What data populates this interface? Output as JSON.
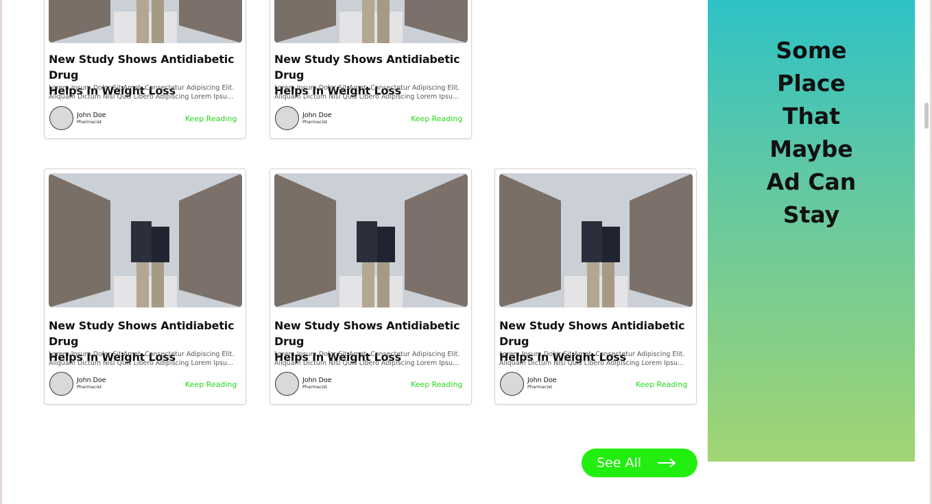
{
  "cards": [
    {
      "title_line1": "New Study Shows Antidiabetic Drug",
      "title_line2": "Helps In Weight Loss",
      "excerpt_line1": "Lorem Ipsum Dolor Sit Amet, Consectetur Adipiscing Elit.",
      "excerpt_line2": "Aliquam Dictum Nisl Quis Libero Adipiscing Lorem Ipsum D...",
      "author_name": "John Doe",
      "author_role": "Pharmacist",
      "cta": "Keep Reading"
    },
    {
      "title_line1": "New Study Shows Antidiabetic Drug",
      "title_line2": "Helps In Weight Loss",
      "excerpt_line1": "Lorem Ipsum Dolor Sit Amet, Consectetur Adipiscing Elit.",
      "excerpt_line2": "Aliquam Dictum Nisl Quis Libero Adipiscing Lorem Ipsum D...",
      "author_name": "John Doe",
      "author_role": "Pharmacist",
      "cta": "Keep Reading"
    },
    {
      "title_line1": "New Study Shows Antidiabetic Drug",
      "title_line2": "Helps In Weight Loss",
      "excerpt_line1": "Lorem Ipsum Dolor Sit Amet, Consectetur Adipiscing Elit.",
      "excerpt_line2": "Aliquam Dictum Nisl Quis Libero Adipiscing Lorem Ipsum D...",
      "author_name": "John Doe",
      "author_role": "Pharmacist",
      "cta": "Keep Reading"
    },
    {
      "title_line1": "New Study Shows Antidiabetic Drug",
      "title_line2": "Helps In Weight Loss",
      "excerpt_line1": "Lorem Ipsum Dolor Sit Amet, Consectetur Adipiscing Elit.",
      "excerpt_line2": "Aliquam Dictum Nisl Quis Libero Adipiscing Lorem Ipsum D...",
      "author_name": "John Doe",
      "author_role": "Pharmacist",
      "cta": "Keep Reading"
    },
    {
      "title_line1": "New Study Shows Antidiabetic Drug",
      "title_line2": "Helps In Weight Loss",
      "excerpt_line1": "Lorem Ipsum Dolor Sit Amet, Consectetur Adipiscing Elit.",
      "excerpt_line2": "Aliquam Dictum Nisl Quis Libero Adipiscing Lorem Ipsum D...",
      "author_name": "John Doe",
      "author_role": "Pharmacist",
      "cta": "Keep Reading"
    }
  ],
  "see_all": {
    "label": "See All",
    "icon": "arrow-right-icon"
  },
  "ad": {
    "lines": [
      "Some",
      "Place",
      "That",
      "Maybe",
      "Ad Can",
      "Stay"
    ],
    "gradient_top": "#2ec2c6",
    "gradient_bottom": "#a2d573"
  },
  "colors": {
    "accent_green": "#22ee10",
    "link_green": "#27d71c"
  }
}
